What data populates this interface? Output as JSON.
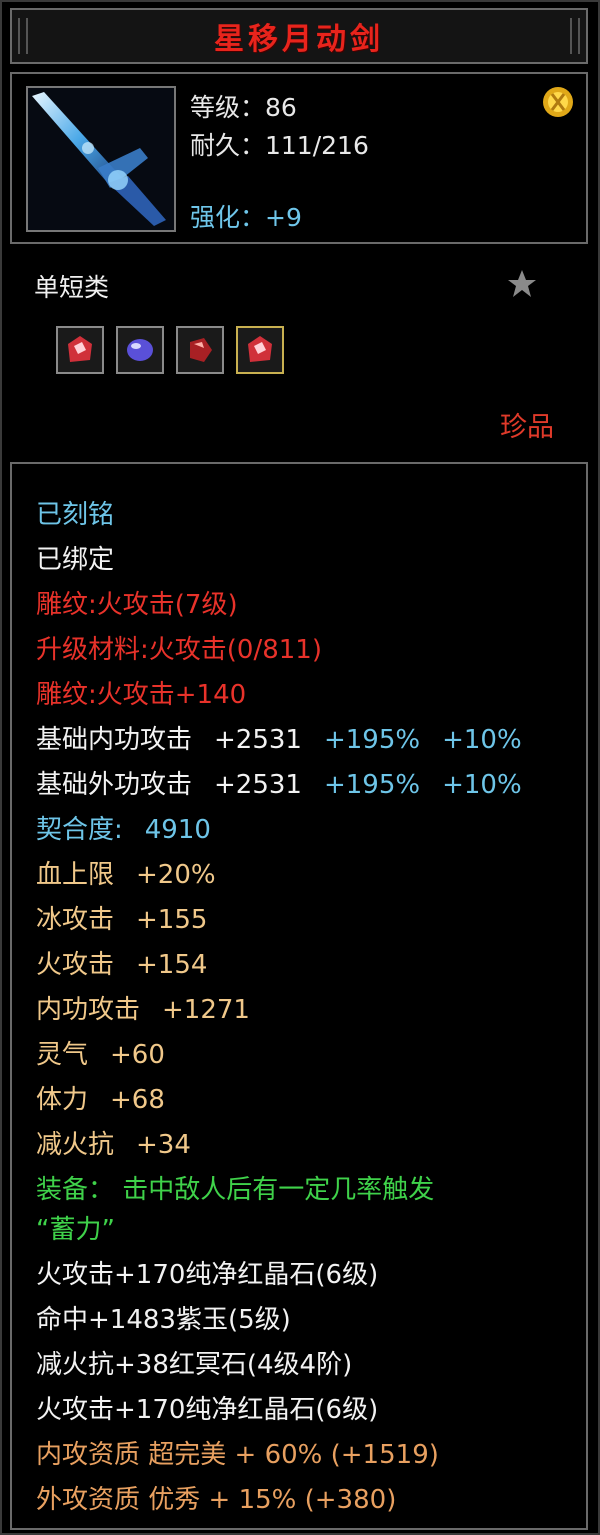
{
  "item": {
    "name": "星移月动剑",
    "level_label": "等级：86",
    "durability_label": "耐久：111/216",
    "enhance_label": "强化：+9",
    "category": "单短类",
    "rarity": "珍品",
    "icons": {
      "item": "sword-icon",
      "badge": "gold-medal-icon",
      "favorite": "star-icon"
    },
    "gems": [
      {
        "name": "red-crystal-gem",
        "color": "#d0303a"
      },
      {
        "name": "purple-jade-gem",
        "color": "#5a50d8"
      },
      {
        "name": "dark-red-gem",
        "color": "#a82024"
      },
      {
        "name": "red-crystal-gem",
        "color": "#d0303a"
      }
    ]
  },
  "attributes": {
    "engraved": "已刻铭",
    "bound": "已绑定",
    "carving1": "雕纹:火攻击(7级)",
    "upgrade": "升级材料:火攻击(0/811)",
    "carving2": "雕纹:火攻击+140",
    "inner_base": {
      "label": "基础内功攻击",
      "value": "+2531",
      "pct1": "+195%",
      "pct2": "+10%"
    },
    "outer_base": {
      "label": "基础外功攻击",
      "value": "+2531",
      "pct1": "+195%",
      "pct2": "+10%"
    },
    "fit": {
      "label": "契合度:",
      "value": "4910"
    },
    "stats": [
      {
        "label": "血上限",
        "value": "+20%"
      },
      {
        "label": "冰攻击",
        "value": "+155"
      },
      {
        "label": "火攻击",
        "value": "+154"
      },
      {
        "label": "内功攻击",
        "value": "+1271"
      },
      {
        "label": "灵气",
        "value": "+60"
      },
      {
        "label": "体力",
        "value": "+68"
      },
      {
        "label": "减火抗",
        "value": "+34"
      }
    ],
    "equip_effect": "装备： 击中敌人后有一定几率触发",
    "equip_effect2": "“蓄力”",
    "gem_lines": [
      "火攻击+170纯净红晶石(6级)",
      "命中+1483紫玉(5级)",
      "减火抗+38红冥石(4级4阶)",
      "火攻击+170纯净红晶石(6级)"
    ],
    "inner_quality": "内攻资质 超完美 + 60% (+1519)",
    "outer_quality": "外攻资质 优秀 + 15% (+380)"
  },
  "colors": {
    "title": "#e8241c",
    "cyan": "#6ec5e8",
    "red": "#e8322a",
    "gold": "#f0c88a",
    "green": "#3fd24a",
    "orange": "#e8a060"
  }
}
